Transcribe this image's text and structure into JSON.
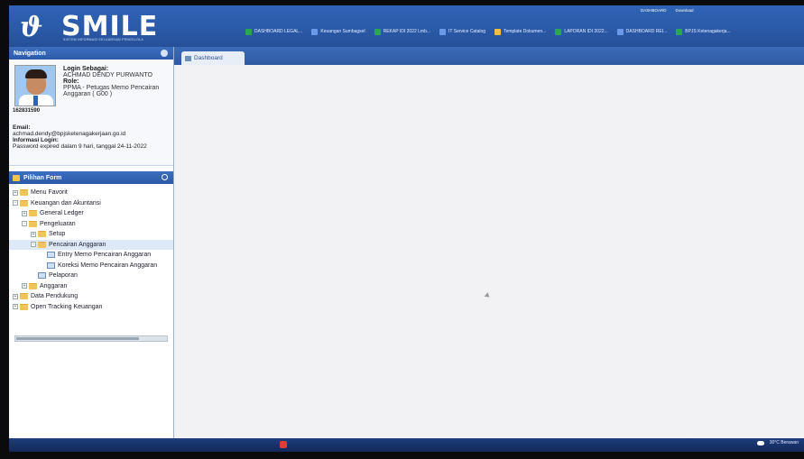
{
  "app": {
    "logo_mark": "ϑ",
    "logo_text": "SMILE",
    "logo_subtitle": "SISTEM INFORMASI KELUARGAN PENGELOLA"
  },
  "browser": {
    "bookmarks_row1": [
      "DASHBOARD LEGAL...",
      "Keuangan Sumbagsel",
      "REKAP IDI 2022 Lmb...",
      "IT Service Catalog",
      "Template Dokumen...",
      "LAPORAN IDI 2022...",
      "DASHBOARD REI...",
      "BPJS Ketenagakerja..."
    ],
    "tabs": [
      "DASHBOARD",
      "Download"
    ]
  },
  "navigation": {
    "title": "Navigation",
    "user_id": "162831590",
    "login_label": "Login Sebagai:",
    "login_value": "ACHMAD DENDY PURWANTO",
    "role_label": "Role:",
    "role_value": "PPMA - Petugas Memo Pencairan Anggaran ( G00 )",
    "email_label": "Email:",
    "email_value": "achmad.dendy@bpjsketenagakerjaan.go.id",
    "login_info_label": "Informasi Login:",
    "login_info_value": "Password expired dalam 9 hari, tanggal 24-11-2022"
  },
  "form_panel": {
    "title": "Pilihan Form",
    "tree": [
      {
        "label": "Menu Favorit",
        "indent": 0,
        "kind": "folder",
        "exp": "+"
      },
      {
        "label": "Keuangan dan Akuntansi",
        "indent": 0,
        "kind": "folder",
        "exp": "-"
      },
      {
        "label": "General Ledger",
        "indent": 1,
        "kind": "folder",
        "exp": "+"
      },
      {
        "label": "Pengeluaran",
        "indent": 1,
        "kind": "folder",
        "exp": "-"
      },
      {
        "label": "Setup",
        "indent": 2,
        "kind": "folder",
        "exp": "+"
      },
      {
        "label": "Pencairan Anggaran",
        "indent": 2,
        "kind": "folder",
        "exp": "-",
        "selected": true
      },
      {
        "label": "Entry Memo Pencairan Anggaran",
        "indent": 3,
        "kind": "doc"
      },
      {
        "label": "Koreksi Memo Pencairan Anggaran",
        "indent": 3,
        "kind": "doc"
      },
      {
        "label": "Pelaporan",
        "indent": 2,
        "kind": "doc"
      },
      {
        "label": "Anggaran",
        "indent": 1,
        "kind": "folder",
        "exp": "+"
      },
      {
        "label": "Data Pendukung",
        "indent": 0,
        "kind": "folder",
        "exp": "+"
      },
      {
        "label": "Open Tracking Keuangan",
        "indent": 0,
        "kind": "folder",
        "exp": "+"
      }
    ]
  },
  "main": {
    "tab_label": "Dashboard"
  },
  "taskbar": {
    "weather": "30°C Berawan"
  },
  "colors": {
    "header": "#2f63b6",
    "sidebar_bg": "#ffffff",
    "content_bg": "#f2f2f4"
  }
}
